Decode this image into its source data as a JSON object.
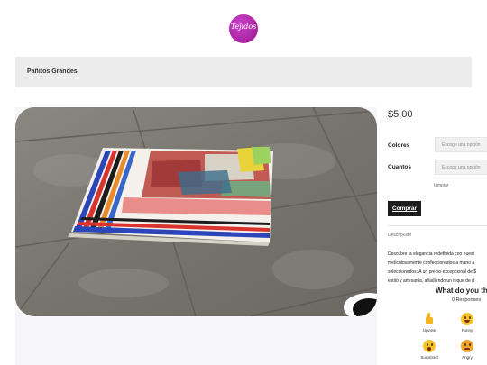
{
  "logo": {
    "text": "Tejidos"
  },
  "breadcrumb": {
    "title": "Pañitos Grandes"
  },
  "product": {
    "price": "$5.00",
    "colors_label": "Colores",
    "colors_placeholder": "Escoge una opción",
    "quantity_label": "Cuantos",
    "quantity_placeholder": "Escoge una opción",
    "clear_label": "Limpiar",
    "buy_label": "Comprar",
    "description_tab": "Descripción",
    "description_lines": [
      "Descubre la elegancia redefinida con nuest",
      "meticulosamente confeccionados a mano a",
      "seleccionados. A un precio excepcional de $",
      "estilo y artesanía, añadiendo un toque de d"
    ]
  },
  "reactions": {
    "title": "What do you th",
    "count": "0 Responses",
    "items": [
      {
        "label": "Upvote",
        "icon": "thumbs-up-icon"
      },
      {
        "label": "Funny",
        "icon": "laughing-face-icon"
      },
      {
        "label": "Surprised",
        "icon": "surprised-face-icon"
      },
      {
        "label": "Angry",
        "icon": "angry-face-icon"
      }
    ]
  },
  "colors": {
    "brand": "#a8239f",
    "button": "#1d1d1d",
    "crumb_bg": "#ececec"
  }
}
